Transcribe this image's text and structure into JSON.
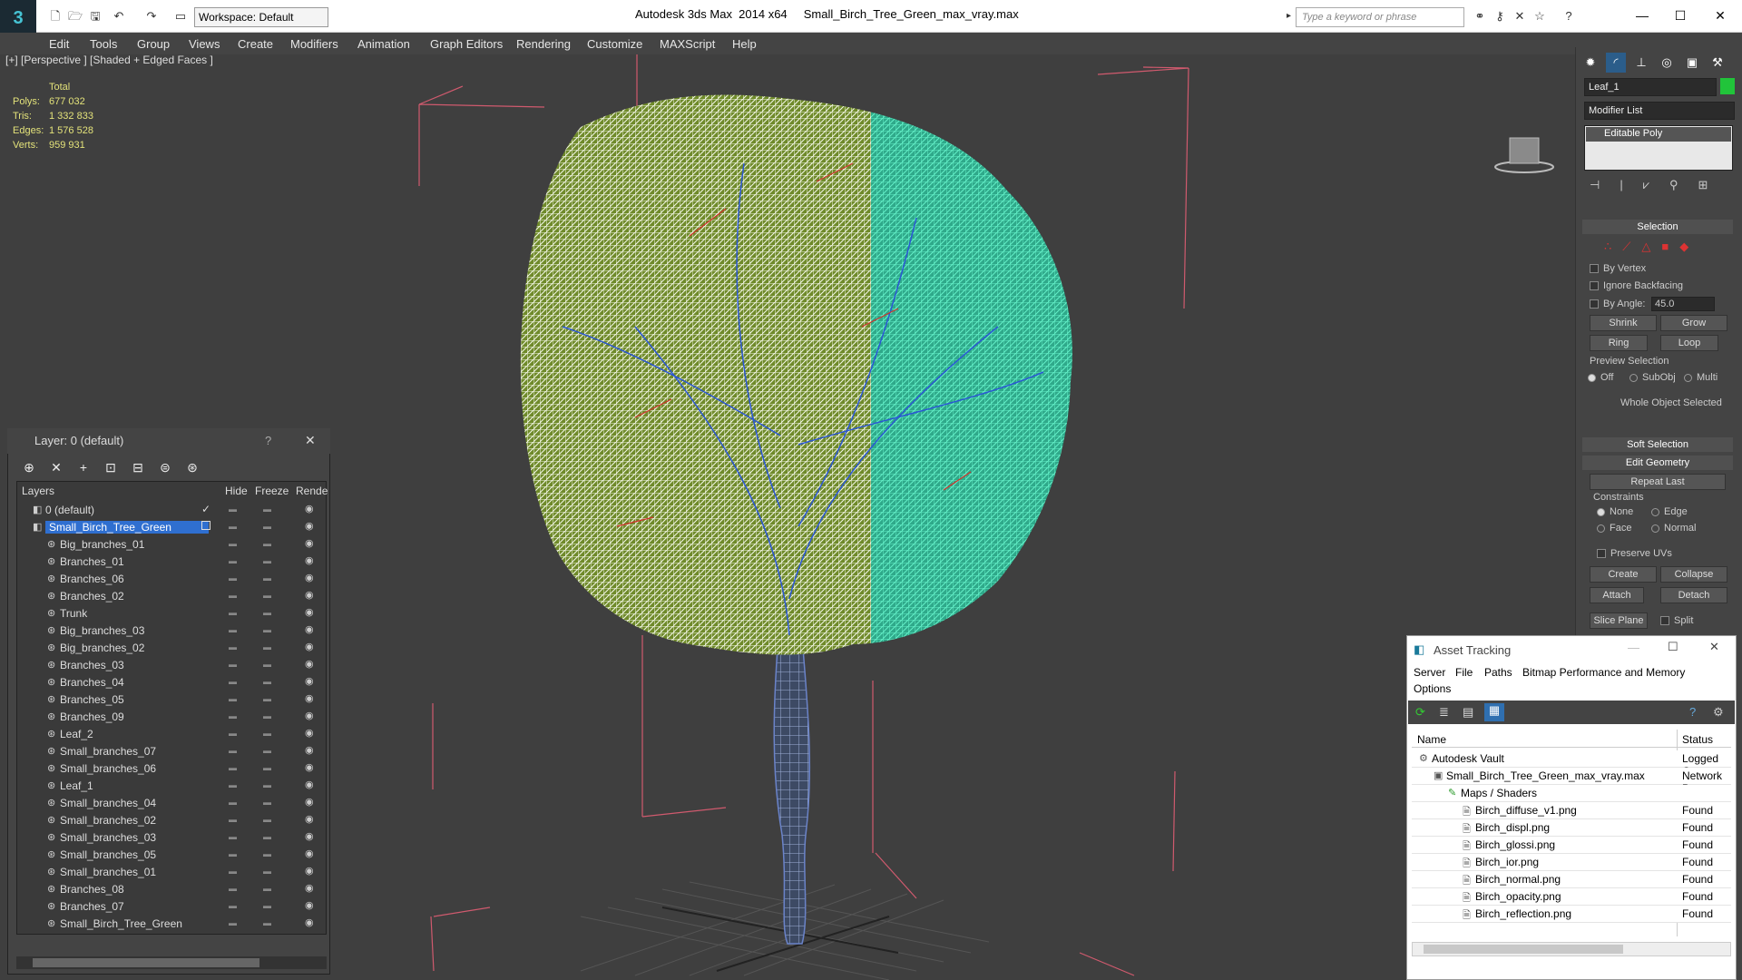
{
  "app": {
    "title": "Autodesk 3ds Max  2014 x64     Small_Birch_Tree_Green_max_vray.max",
    "workspace": "Workspace: Default",
    "search_placeholder": "Type a keyword or phrase"
  },
  "menu": [
    "Edit",
    "Tools",
    "Group",
    "Views",
    "Create",
    "Modifiers",
    "Animation",
    "Graph Editors",
    "Rendering",
    "Customize",
    "MAXScript",
    "Help"
  ],
  "viewport": {
    "label": "[+] [Perspective ] [Shaded + Edged Faces ]",
    "stats": {
      "header": "Total",
      "polys_label": "Polys:",
      "polys": "677 032",
      "tris_label": "Tris:",
      "tris": "1 332 833",
      "edges_label": "Edges:",
      "edges": "1 576 528",
      "verts_label": "Verts:",
      "verts": "959 931"
    }
  },
  "command_panel": {
    "object_name": "Leaf_1",
    "object_color": "#21c43a",
    "modifier_list": "Modifier List",
    "stack_item": "Editable Poly",
    "selection": {
      "title": "Selection",
      "by_vertex": "By Vertex",
      "ignore_backfacing": "Ignore Backfacing",
      "by_angle": "By Angle:",
      "angle_value": "45.0",
      "shrink": "Shrink",
      "grow": "Grow",
      "ring": "Ring",
      "loop": "Loop",
      "preview_selection": "Preview Selection",
      "off": "Off",
      "subobj": "SubObj",
      "multi": "Multi",
      "status": "Whole Object Selected"
    },
    "soft_selection": "Soft Selection",
    "edit_geometry": {
      "title": "Edit Geometry",
      "repeat_last": "Repeat Last",
      "constraints": "Constraints",
      "none": "None",
      "edge": "Edge",
      "face": "Face",
      "normal": "Normal",
      "preserve_uvs": "Preserve UVs",
      "create": "Create",
      "collapse": "Collapse",
      "attach": "Attach",
      "detach": "Detach",
      "slice_plane": "Slice Plane",
      "split": "Split"
    }
  },
  "layer_panel": {
    "title": "Layer: 0 (default)",
    "help": "?",
    "close": "✕",
    "col_layers": "Layers",
    "col_hide": "Hide",
    "col_freeze": "Freeze",
    "col_render": "Rende",
    "rows": [
      {
        "name": "0 (default)",
        "level": 0
      },
      {
        "name": "Small_Birch_Tree_Green",
        "level": 0,
        "selected": true
      },
      {
        "name": "Big_branches_01",
        "level": 1
      },
      {
        "name": "Branches_01",
        "level": 1
      },
      {
        "name": "Branches_06",
        "level": 1
      },
      {
        "name": "Branches_02",
        "level": 1
      },
      {
        "name": "Trunk",
        "level": 1
      },
      {
        "name": "Big_branches_03",
        "level": 1
      },
      {
        "name": "Big_branches_02",
        "level": 1
      },
      {
        "name": "Branches_03",
        "level": 1
      },
      {
        "name": "Branches_04",
        "level": 1
      },
      {
        "name": "Branches_05",
        "level": 1
      },
      {
        "name": "Branches_09",
        "level": 1
      },
      {
        "name": "Leaf_2",
        "level": 1
      },
      {
        "name": "Small_branches_07",
        "level": 1
      },
      {
        "name": "Small_branches_06",
        "level": 1
      },
      {
        "name": "Leaf_1",
        "level": 1
      },
      {
        "name": "Small_branches_04",
        "level": 1
      },
      {
        "name": "Small_branches_02",
        "level": 1
      },
      {
        "name": "Small_branches_03",
        "level": 1
      },
      {
        "name": "Small_branches_05",
        "level": 1
      },
      {
        "name": "Small_branches_01",
        "level": 1
      },
      {
        "name": "Branches_08",
        "level": 1
      },
      {
        "name": "Branches_07",
        "level": 1
      },
      {
        "name": "Small_Birch_Tree_Green",
        "level": 1
      }
    ]
  },
  "asset_tracking": {
    "title": "Asset Tracking",
    "menu": [
      "Server",
      "File",
      "Paths",
      "Bitmap Performance and Memory"
    ],
    "menu2": "Options",
    "col_name": "Name",
    "col_status": "Status",
    "rows": [
      {
        "name": "Autodesk Vault",
        "status": "Logged Ou",
        "level": 0
      },
      {
        "name": "Small_Birch_Tree_Green_max_vray.max",
        "status": "Network P",
        "level": 1
      },
      {
        "name": "Maps / Shaders",
        "status": "",
        "level": 2
      },
      {
        "name": "Birch_diffuse_v1.png",
        "status": "Found",
        "level": 3
      },
      {
        "name": "Birch_displ.png",
        "status": "Found",
        "level": 3
      },
      {
        "name": "Birch_glossi.png",
        "status": "Found",
        "level": 3
      },
      {
        "name": "Birch_ior.png",
        "status": "Found",
        "level": 3
      },
      {
        "name": "Birch_normal.png",
        "status": "Found",
        "level": 3
      },
      {
        "name": "Birch_opacity.png",
        "status": "Found",
        "level": 3
      },
      {
        "name": "Birch_reflection.png",
        "status": "Found",
        "level": 3
      }
    ]
  }
}
